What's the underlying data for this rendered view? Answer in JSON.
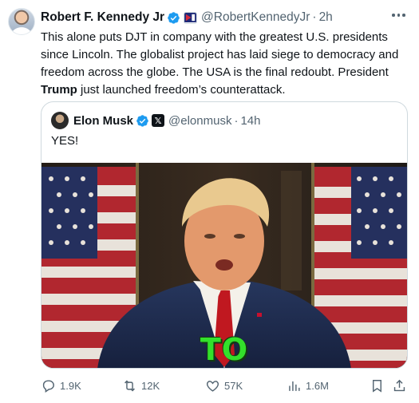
{
  "post": {
    "author_name": "Robert F. Kennedy Jr",
    "handle": "@RobertKennedyJr",
    "time": "2h",
    "text_before": "This alone puts DJT in company with the greatest U.S. presidents since Lincoln. The globalist project has laid siege to democracy and freedom across the globe. The USA is the final redoubt. President ",
    "text_bold": "Trump",
    "text_after": " just launched freedom’s counterattack."
  },
  "quote": {
    "author_name": "Elon Musk",
    "handle": "@elonmusk",
    "time": "14h",
    "text": "YES!",
    "video_caption": "TO"
  },
  "actions": {
    "replies": "1.9K",
    "reposts": "12K",
    "likes": "57K",
    "views": "1.6M"
  },
  "colors": {
    "verified_blue": "#1d9bf0",
    "caption_green": "#33e02b",
    "secondary_text": "#536471"
  }
}
